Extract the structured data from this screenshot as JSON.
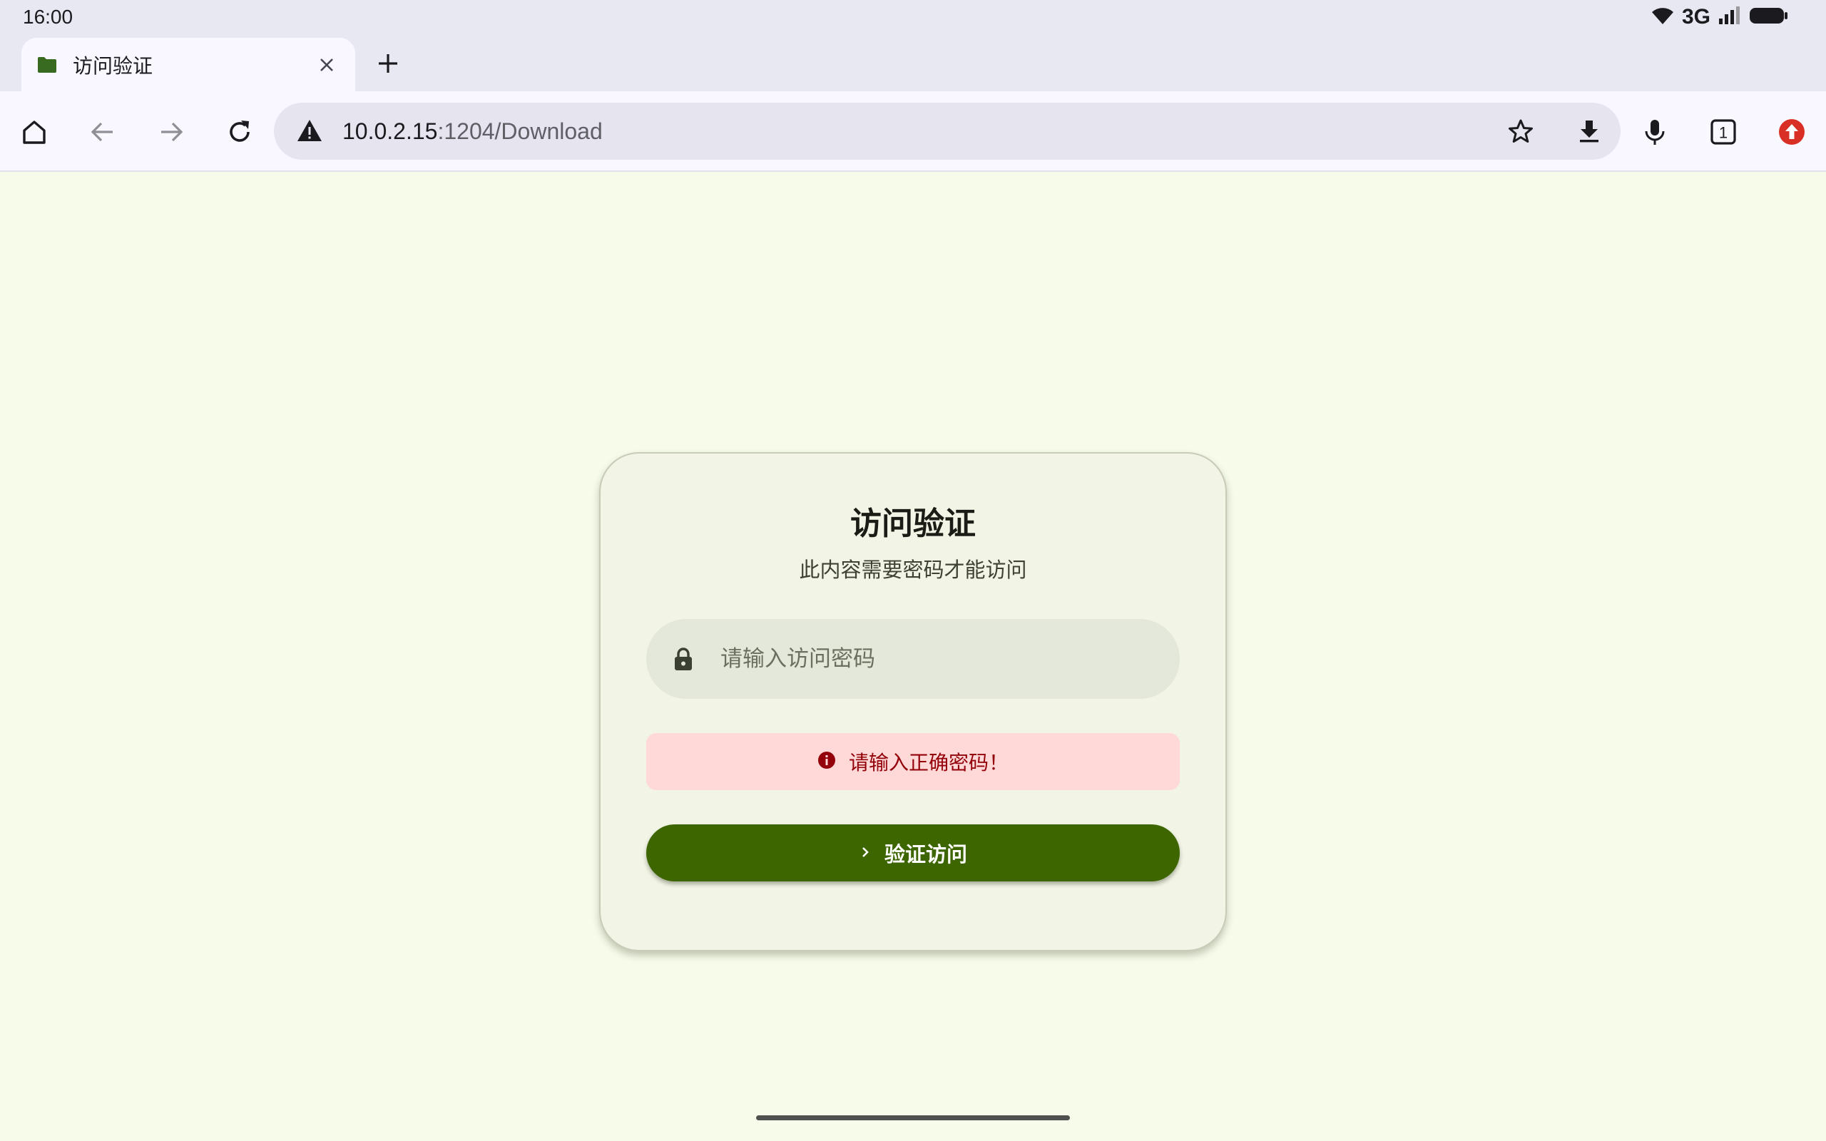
{
  "status_bar": {
    "time": "16:00",
    "network": "3G",
    "icons": [
      "wifi-icon",
      "signal-icon",
      "battery-icon"
    ]
  },
  "tab": {
    "title": "访问验证",
    "favicon": "folder-icon"
  },
  "toolbar": {
    "url_host": "10.0.2.15",
    "url_path": ":1204/Download",
    "tab_count": "1",
    "icons": [
      "home-icon",
      "back-icon",
      "forward-icon",
      "reload-icon",
      "not-secure-icon",
      "star-icon",
      "download-icon",
      "mic-icon",
      "tab-switcher-icon",
      "update-icon"
    ]
  },
  "card": {
    "title": "访问验证",
    "subtitle": "此内容需要密码才能访问",
    "password_placeholder": "请输入访问密码",
    "password_value": "",
    "error_message": "请输入正确密码！",
    "button_label": "验证访问"
  },
  "colors": {
    "page_background": "#f6fbea",
    "card_background": "#f2f4e6",
    "button": "#3d6600",
    "error_background": "#ffd9d7",
    "error_text": "#93000a",
    "favicon": "#386a20",
    "update_badge": "#d93025"
  }
}
